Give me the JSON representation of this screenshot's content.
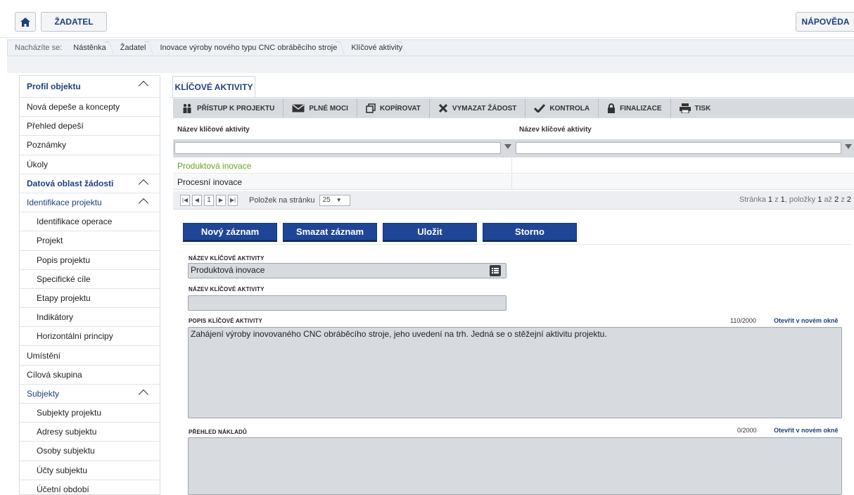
{
  "topbar": {
    "home_icon": "home-icon",
    "zadatel_label": "ŽADATEL",
    "help_label": "NÁPOVĚDA"
  },
  "breadcrumb": {
    "prefix": "Nacházíte se:",
    "items": [
      "Nástěnka",
      "Žadatel",
      "Inovace výroby nového typu CNC obráběcího stroje",
      "Klíčové aktivity"
    ]
  },
  "sidebar": {
    "items": [
      {
        "label": "Profil objektu",
        "kind": "head",
        "expanded": true
      },
      {
        "label": "Nová depeše a koncepty",
        "kind": "item"
      },
      {
        "label": "Přehled depeší",
        "kind": "item"
      },
      {
        "label": "Poznámky",
        "kind": "item"
      },
      {
        "label": "Úkoly",
        "kind": "item"
      },
      {
        "label": "Datová oblast žádosti",
        "kind": "head",
        "expanded": true
      },
      {
        "label": "Identifikace projektu",
        "kind": "sub",
        "expanded": true
      },
      {
        "label": "Identifikace operace",
        "kind": "child"
      },
      {
        "label": "Projekt",
        "kind": "child"
      },
      {
        "label": "Popis projektu",
        "kind": "child"
      },
      {
        "label": "Specifické cíle",
        "kind": "child"
      },
      {
        "label": "Etapy projektu",
        "kind": "child"
      },
      {
        "label": "Indikátory",
        "kind": "child"
      },
      {
        "label": "Horizontální principy",
        "kind": "child"
      },
      {
        "label": "Umístění",
        "kind": "item"
      },
      {
        "label": "Cílová skupina",
        "kind": "item"
      },
      {
        "label": "Subjekty",
        "kind": "sub",
        "expanded": true
      },
      {
        "label": "Subjekty projektu",
        "kind": "child"
      },
      {
        "label": "Adresy subjektu",
        "kind": "child"
      },
      {
        "label": "Osoby subjektu",
        "kind": "child"
      },
      {
        "label": "Účty subjektu",
        "kind": "child"
      },
      {
        "label": "Účetní období",
        "kind": "child"
      }
    ]
  },
  "main": {
    "tab_label": "KLÍČOVÉ AKTIVITY",
    "toolbar": [
      {
        "label": "PŘÍSTUP K PROJEKTU",
        "icon": "people-icon"
      },
      {
        "label": "PLNÉ MOCI",
        "icon": "envelope-icon"
      },
      {
        "label": "KOPÍROVAT",
        "icon": "copy-icon"
      },
      {
        "label": "VYMAZAT ŽÁDOST",
        "icon": "delete-x-icon"
      },
      {
        "label": "KONTROLA",
        "icon": "checkmark-icon"
      },
      {
        "label": "FINALIZACE",
        "icon": "lock-icon"
      },
      {
        "label": "TISK",
        "icon": "printer-icon"
      }
    ],
    "grid": {
      "columns": [
        "Název klíčové aktivity",
        "Název klíčové aktivity"
      ],
      "rows": [
        {
          "c1": "Produktová inovace",
          "c2": "",
          "selected": true
        },
        {
          "c1": "Procesní inovace",
          "c2": ""
        }
      ]
    },
    "pager": {
      "current_page": "1",
      "per_page_label": "Položek na stránku",
      "per_page_value": "25",
      "info_prefix": "Stránka",
      "page": "1",
      "of": "z",
      "total_pages": "1",
      "items_label": ", položky",
      "from": "1",
      "to_word": "až",
      "to": "2",
      "total_items": "2"
    },
    "actions": {
      "new": "Nový záznam",
      "delete": "Smazat záznam",
      "save": "Uložit",
      "cancel": "Storno"
    },
    "form": {
      "name_label": "NÁZEV KLÍČOVÉ AKTIVITY",
      "name_value": "Produktová inovace",
      "name2_label": "NÁZEV KLÍČOVÉ AKTIVITY",
      "name2_value": "",
      "desc_label": "POPIS KLÍČOVÉ AKTIVITY",
      "desc_counter": "110/2000",
      "desc_link": "Otevřít v novém okně",
      "desc_value": "Zahájení výroby inovovaného CNC obráběcího stroje, jeho uvedení na trh. Jedná se o stěžejní aktivitu projektu.",
      "costs_label": "PŘEHLED NÁKLADŮ",
      "costs_counter": "0/2000",
      "costs_link": "Otevřít v novém okně",
      "costs_value": ""
    }
  },
  "colors": {
    "brand": "#1d3f7c",
    "button": "#1f4696",
    "selected_row": "#6aa321",
    "toolbar": "#d7dbe0"
  }
}
